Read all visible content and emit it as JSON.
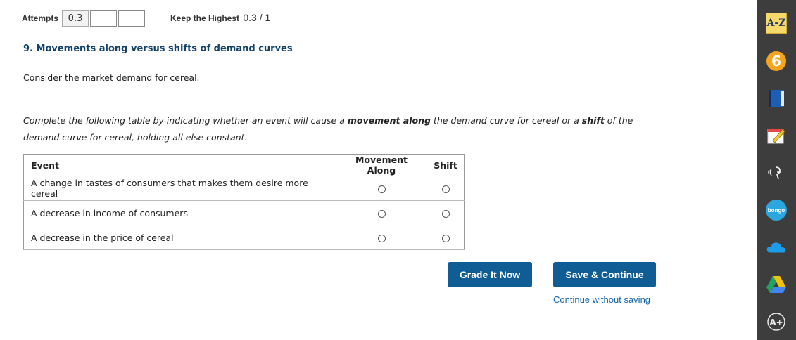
{
  "attempts": {
    "label": "Attempts",
    "value": "0.3"
  },
  "keep_highest": {
    "label": "Keep the Highest",
    "score": "0.3 / 1"
  },
  "question": {
    "title": "9. Movements along versus shifts of demand curves",
    "consider": "Consider the market demand for cereal.",
    "instr_part1": "Complete the following table by indicating whether an event will cause a ",
    "instr_bold1": "movement along",
    "instr_part2": " the demand curve for cereal or a ",
    "instr_bold2": "shift",
    "instr_part3": " of the demand curve for cereal, holding all else constant."
  },
  "table": {
    "headers": [
      "Event",
      "Movement Along",
      "Shift"
    ],
    "rows": [
      {
        "event": "A change in tastes of consumers that makes them desire more cereal"
      },
      {
        "event": "A decrease in income of consumers"
      },
      {
        "event": "A decrease in the price of cereal"
      }
    ]
  },
  "buttons": {
    "grade": "Grade It Now",
    "save": "Save & Continue",
    "continue_link": "Continue without saving"
  },
  "toolbar": {
    "az_label": "A-Z",
    "bongo_label": "bongo",
    "colors": {
      "bg": "#3d3d3d",
      "accent": "#f4a41d",
      "button": "#0f5d94"
    }
  }
}
